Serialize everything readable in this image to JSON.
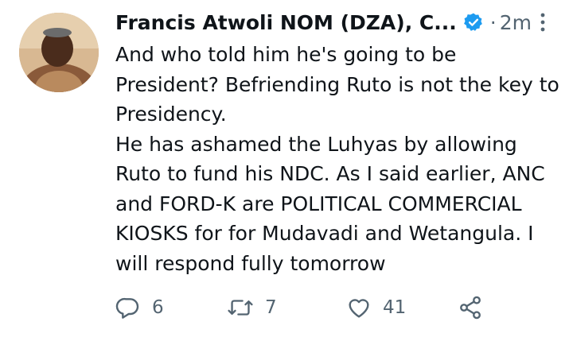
{
  "tweet": {
    "author_name": "Francis Atwoli NOM (DZA), C...",
    "separator": "·",
    "timestamp": "2m",
    "text": "And who told him he's going to be President? Befriending Ruto is not the key to Presidency.\nHe has ashamed the Luhyas by allowing Ruto to fund his NDC. As I said earlier, ANC and FORD-K are POLITICAL COMMERCIAL KIOSKS for for Mudavadi and Wetangula. I will respond fully tomorrow",
    "verified": true
  },
  "actions": {
    "reply_count": "6",
    "retweet_count": "7",
    "like_count": "41"
  },
  "icons": {
    "verified": "verified-badge-icon",
    "more": "more-vertical-icon",
    "reply": "reply-icon",
    "retweet": "retweet-icon",
    "like": "heart-icon",
    "share": "share-icon"
  },
  "colors": {
    "text": "#0f1419",
    "secondary": "#536471",
    "verified": "#1d9bf0",
    "background": "#ffffff"
  }
}
